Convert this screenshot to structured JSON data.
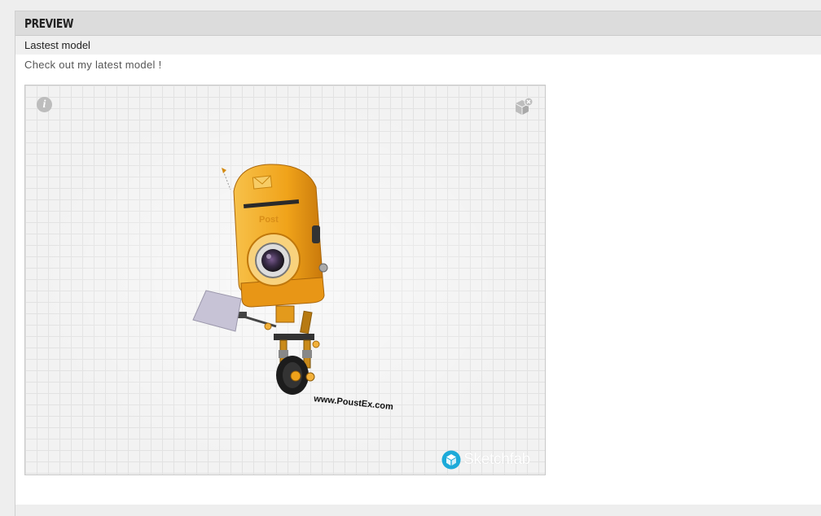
{
  "panel": {
    "title": "PREVIEW",
    "subtitle": "Lastest model",
    "description": "Check out my latest model !"
  },
  "viewer": {
    "info_icon": "info-icon",
    "box_icon": "box-icon",
    "brand_name": "Sketchfab",
    "model_caption": "www.PoustEx.com",
    "model_mailbox_text": "Post",
    "accent_color": "#f4a91c"
  }
}
